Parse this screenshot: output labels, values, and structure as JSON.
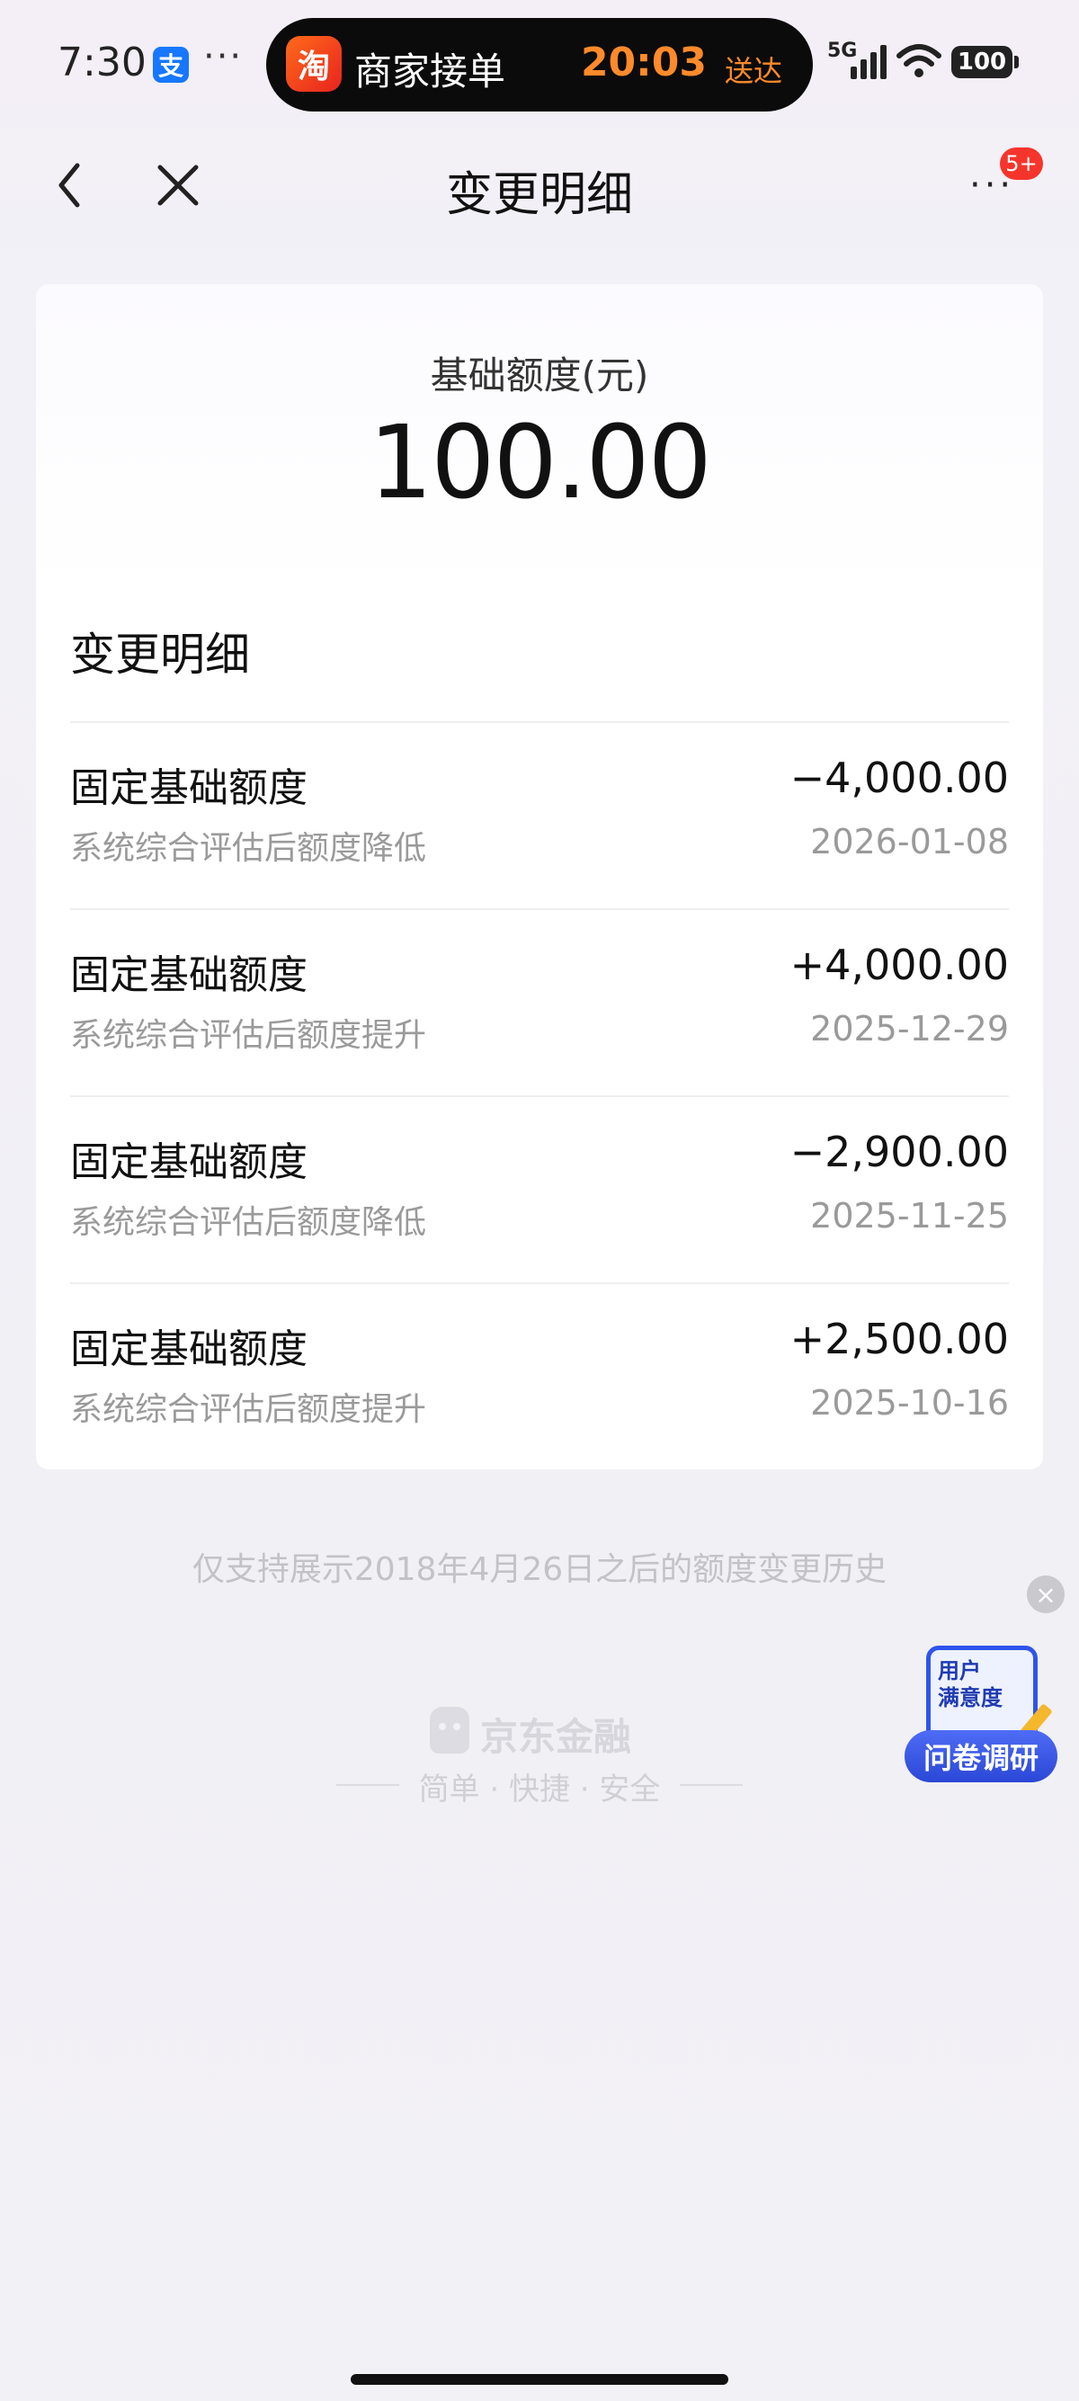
{
  "status_bar": {
    "time": "7:30",
    "alipay_badge": "支",
    "more": "···",
    "island_app_icon": "淘",
    "island_title": "商家接单",
    "island_time": "20:03",
    "island_sub": "送达",
    "network": "5G",
    "battery": "100"
  },
  "nav": {
    "title": "变更明细",
    "more": "···",
    "badge": "5+"
  },
  "card": {
    "label": "基础额度(元)",
    "amount": "100.00",
    "section_title": "变更明细",
    "records": [
      {
        "title": "固定基础额度",
        "desc": "系统综合评估后额度降低",
        "amount": "−4,000.00",
        "date": "2026-01-08"
      },
      {
        "title": "固定基础额度",
        "desc": "系统综合评估后额度提升",
        "amount": "+4,000.00",
        "date": "2025-12-29"
      },
      {
        "title": "固定基础额度",
        "desc": "系统综合评估后额度降低",
        "amount": "−2,900.00",
        "date": "2025-11-25"
      },
      {
        "title": "固定基础额度",
        "desc": "系统综合评估后额度提升",
        "amount": "+2,500.00",
        "date": "2025-10-16"
      }
    ]
  },
  "footnote": "仅支持展示2018年4月26日之后的额度变更历史",
  "brand": {
    "name": "京东金融",
    "slogan": "简单 · 快捷 · 安全"
  },
  "survey": {
    "close": "×",
    "board_text_line1": "用户",
    "board_text_line2": "满意度",
    "button": "问卷调研"
  }
}
